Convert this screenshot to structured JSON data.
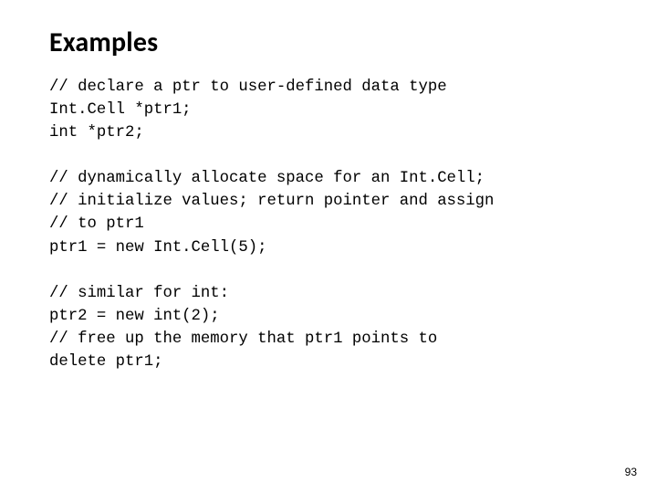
{
  "slide": {
    "title": "Examples",
    "page_number": "93",
    "code": {
      "l01": "// declare a ptr to user-defined data type",
      "l02": "Int.Cell *ptr1;",
      "l03": "int *ptr2;",
      "l04": "",
      "l05": "// dynamically allocate space for an Int.Cell;",
      "l06": "// initialize values; return pointer and assign",
      "l07": "// to ptr1",
      "l08": "ptr1 = new Int.Cell(5);",
      "l09": "",
      "l10": "// similar for int:",
      "l11": "ptr2 = new int(2);",
      "l12": "// free up the memory that ptr1 points to",
      "l13": "delete ptr1;"
    }
  }
}
